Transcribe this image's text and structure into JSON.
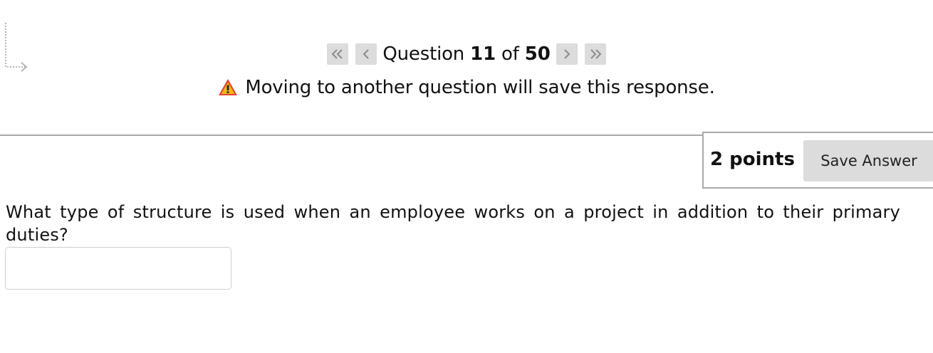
{
  "navigation": {
    "first_label": "«",
    "prev_label": "‹",
    "next_label": "›",
    "last_label": "»",
    "question_word": "Question",
    "current": "11",
    "of_word": "of",
    "total": "50"
  },
  "warning": {
    "icon": "warning-triangle-icon",
    "text": "Moving to another question will save this response."
  },
  "points": {
    "label": "2 points",
    "save_button": "Save Answer"
  },
  "question": {
    "text": "What type of structure is used when an employee works on a project in addition to their primary duties?",
    "answer_value": ""
  },
  "colors": {
    "button_bg": "#dcdcdc",
    "button_icon": "#8c8c8c",
    "divider": "#a9a9a9",
    "warning_yellow": "#f2b818",
    "warning_red": "#e0422e"
  }
}
